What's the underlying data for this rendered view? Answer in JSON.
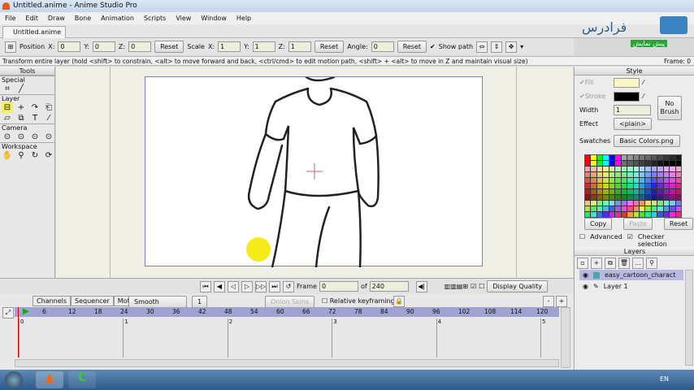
{
  "window": {
    "title": "Untitled.anime - Anime Studio Pro",
    "doc_tab": "Untitled.anime #"
  },
  "menu": [
    "File",
    "Edit",
    "Draw",
    "Bone",
    "Animation",
    "Scripts",
    "View",
    "Window",
    "Help"
  ],
  "toolbar": {
    "position": "Position",
    "x": "X:",
    "y": "Y:",
    "z": "Z:",
    "pos_x": "0",
    "pos_y": "0",
    "pos_z": "0",
    "reset": "Reset",
    "scale": "Scale",
    "scale_x": "1",
    "scale_y": "1",
    "scale_z": "1",
    "angle": "Angle:",
    "angle_val": "0",
    "show_path": "Show path",
    "show_path_checked": true
  },
  "watermark": {
    "logo": "فرادرس",
    "preview": "پیش نمایش"
  },
  "status": {
    "text": "Transform entire layer (hold <shift> to constrain, <alt> to move forward and back, <ctrl/cmd> to edit motion path, <shift> + <alt> to move in Z and maintain visual size)",
    "frame": "Frame: 0"
  },
  "tools": {
    "title": "Tools",
    "sections": [
      "Special",
      "Layer",
      "Camera",
      "Workspace"
    ]
  },
  "style": {
    "title": "Style",
    "fill": "Fill",
    "stroke": "Stroke",
    "fill_color": "#fbf6c4",
    "stroke_color": "#000000",
    "width_label": "Width",
    "width": "1",
    "no_brush": "No Brush",
    "effect_label": "Effect",
    "effect": "<plain>",
    "swatches_label": "Swatches",
    "swatches": "Basic Colors.png",
    "copy": "Copy",
    "paste": "Paste",
    "reset": "Reset",
    "advanced": "Advanced",
    "checker": "Checker selection"
  },
  "layers": {
    "title": "Layers",
    "items": [
      {
        "name": "easy_cartoon_charact",
        "selected": true
      },
      {
        "name": "Layer 1",
        "selected": false
      }
    ]
  },
  "playback": {
    "frame_label": "Frame",
    "frame": "0",
    "of": "of",
    "total": "240",
    "display_quality": "Display Quality"
  },
  "timeline": {
    "tabs": [
      "Channels",
      "Sequencer",
      "Motion Graph"
    ],
    "interp": "Smooth",
    "interval": "1",
    "onion": "Onion Skins",
    "relative": "Relative keyframing",
    "ticks": [
      "6",
      "12",
      "18",
      "24",
      "30",
      "36",
      "42",
      "48",
      "54",
      "60",
      "66",
      "72",
      "78",
      "84",
      "90",
      "96",
      "102",
      "108",
      "114",
      "120"
    ],
    "seconds": [
      "0",
      "1",
      "2",
      "3",
      "4",
      "5"
    ]
  },
  "taskbar": {
    "lang": "EN"
  }
}
